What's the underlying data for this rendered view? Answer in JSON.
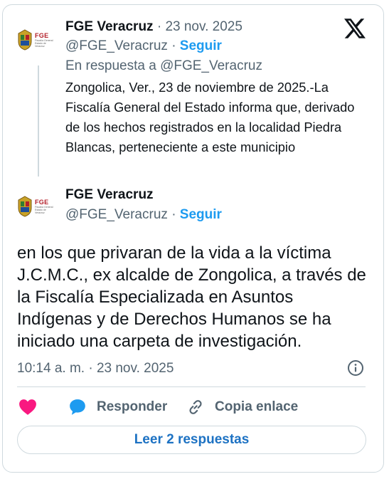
{
  "parent_tweet": {
    "author_name": "FGE Veracruz",
    "date_sep": "·",
    "date": "23 nov. 2025",
    "handle": "@FGE_Veracruz",
    "handle_sep": "·",
    "follow_label": "Seguir",
    "reply_to": "En respuesta a @FGE_Veracruz",
    "text": "Zongolica, Ver., 23 de noviembre de 2025.-La Fiscalía General del Estado informa que, derivado de los hechos registrados en la localidad Piedra Blancas, perteneciente a este municipio"
  },
  "main_tweet": {
    "author_name": "FGE Veracruz",
    "handle": "@FGE_Veracruz",
    "handle_sep": "·",
    "follow_label": "Seguir",
    "text": "en los que privaran de la vida a la víctima J.C.M.C., ex alcalde de Zongolica, a través de la Fiscalía Especializada en Asuntos Indígenas y de Derechos Humanos se ha iniciado una carpeta de investigación.",
    "timestamp": "10:14 a. m. · 23 nov. 2025"
  },
  "avatar": {
    "logo_text": "FGE",
    "logo_subtext": "Fiscalía General Estado de Veracruz"
  },
  "actions": {
    "like_icon": "heart-icon",
    "reply_label": "Responder",
    "reply_icon": "speech-bubble-icon",
    "copy_label": "Copia enlace",
    "copy_icon": "link-icon"
  },
  "read_replies_label": "Leer 2 respuestas",
  "colors": {
    "accent": "#1d9bf0",
    "like": "#f91880",
    "muted": "#536471",
    "border": "#cfd9de",
    "brand_red": "#b3202a"
  }
}
